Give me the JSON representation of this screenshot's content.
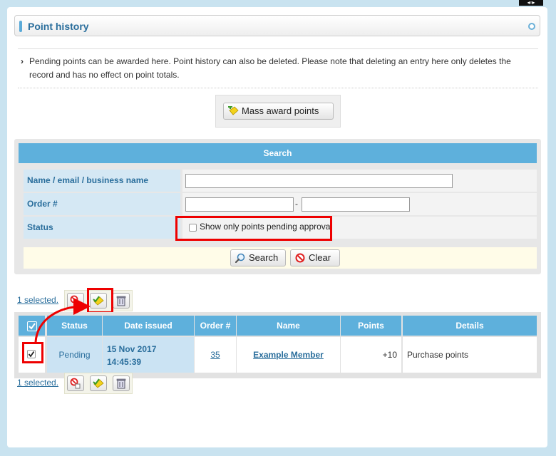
{
  "header": {
    "title": "Point history"
  },
  "notice": {
    "text": "Pending points can be awarded here. Point history can also be deleted. Please note that deleting an entry here only deletes the record and has no effect on point totals."
  },
  "mass_award": {
    "label": "Mass award points"
  },
  "search": {
    "title": "Search",
    "name_label": "Name / email / business name",
    "name_value": "",
    "order_label": "Order #",
    "order_from": "",
    "order_separator": "-",
    "order_to": "",
    "status_label": "Status",
    "status_checkbox_label": "Show only points pending approval",
    "search_button": "Search",
    "clear_button": "Clear"
  },
  "selection": {
    "label": "1 selected."
  },
  "table": {
    "columns": [
      "Status",
      "Date issued",
      "Order #",
      "Name",
      "Points",
      "Details"
    ],
    "rows": [
      {
        "status": "Pending",
        "date": "15 Nov 2017",
        "time": "14:45:39",
        "order": "35",
        "name": "Example Member",
        "points": "+10",
        "details": "Purchase points"
      }
    ]
  },
  "colors": {
    "accent": "#5eb0dc",
    "highlight": "#ee0000",
    "label_bg": "#d5e8f4"
  },
  "icons": [
    "award-icon",
    "search-icon",
    "clear-icon",
    "reject-icon",
    "approve-icon",
    "trash-icon",
    "checkbox-icon"
  ]
}
